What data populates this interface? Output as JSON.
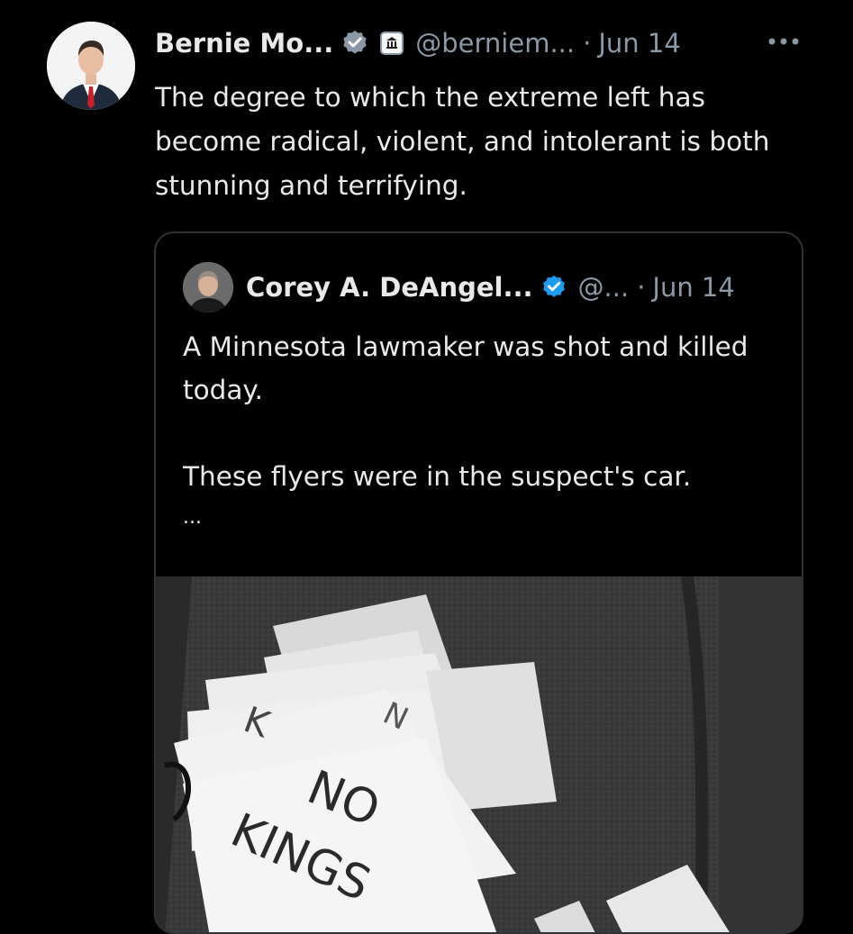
{
  "post": {
    "author_name": "Bernie Mo...",
    "handle": "@berniem...",
    "separator": "·",
    "date": "Jun 14",
    "text": "The degree to which the extreme left has become radical, violent, and intolerant is both stunning and terrifying.",
    "icons": {
      "verified": "verified-badge-icon",
      "affiliation": "government-building-icon",
      "more": "more-options-icon"
    }
  },
  "quote": {
    "author_name": "Corey A. DeAngel...",
    "handle": "@...",
    "separator": "·",
    "date": "Jun 14",
    "text_line1": "A Minnesota lawmaker was shot and killed today.",
    "text_line2": "These flyers were in the suspect's car.",
    "truncation": "...",
    "image": {
      "flyer_text_1": "NO",
      "flyer_text_2": "KINGS"
    }
  },
  "colors": {
    "background": "#000000",
    "text_primary": "#e7e9ea",
    "text_secondary": "#8b98a5",
    "verified_blue": "#1d9bf0",
    "border": "#2f3336"
  }
}
